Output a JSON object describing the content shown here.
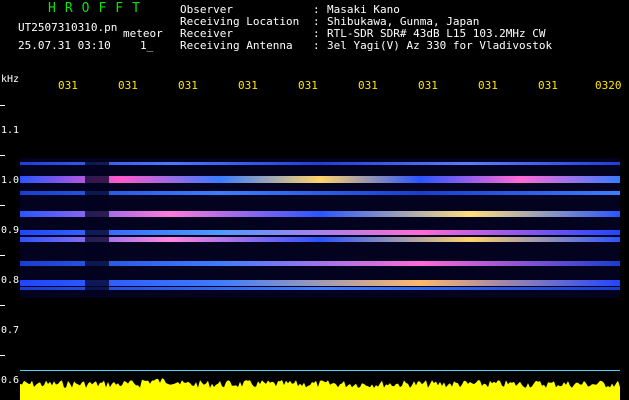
{
  "header": {
    "app_title": "HROFFT",
    "file_name": "UT2507310310.pn",
    "mode": "meteor",
    "datetime": "25.07.31 03:10",
    "page": "1_"
  },
  "info": [
    {
      "label": "Observer",
      "value": "Masaki Kano"
    },
    {
      "label": "Receiving Location",
      "value": "Shibukawa, Gunma, Japan"
    },
    {
      "label": "Receiver",
      "value": "RTL-SDR SDR# 43dB L15 103.2MHz CW"
    },
    {
      "label": "Receiving Antenna",
      "value": "3el Yagi(V) Az 330 for Vladivostok"
    }
  ],
  "axis": {
    "unit": "kHz",
    "freq_labels": [
      "1.1",
      "1.0",
      "0.9",
      "0.8",
      "0.7",
      "0.6"
    ],
    "time_labels": [
      "031",
      "031",
      "031",
      "031",
      "031",
      "031",
      "031",
      "031",
      "031",
      "0320"
    ]
  },
  "colors": {
    "title": "#0fe00f",
    "text": "#ffffff",
    "time_labels": "#ffe600",
    "spectrum_bg": "#030320",
    "noise_trace": "#ffff00",
    "baseline": "#3fd6ff"
  }
}
